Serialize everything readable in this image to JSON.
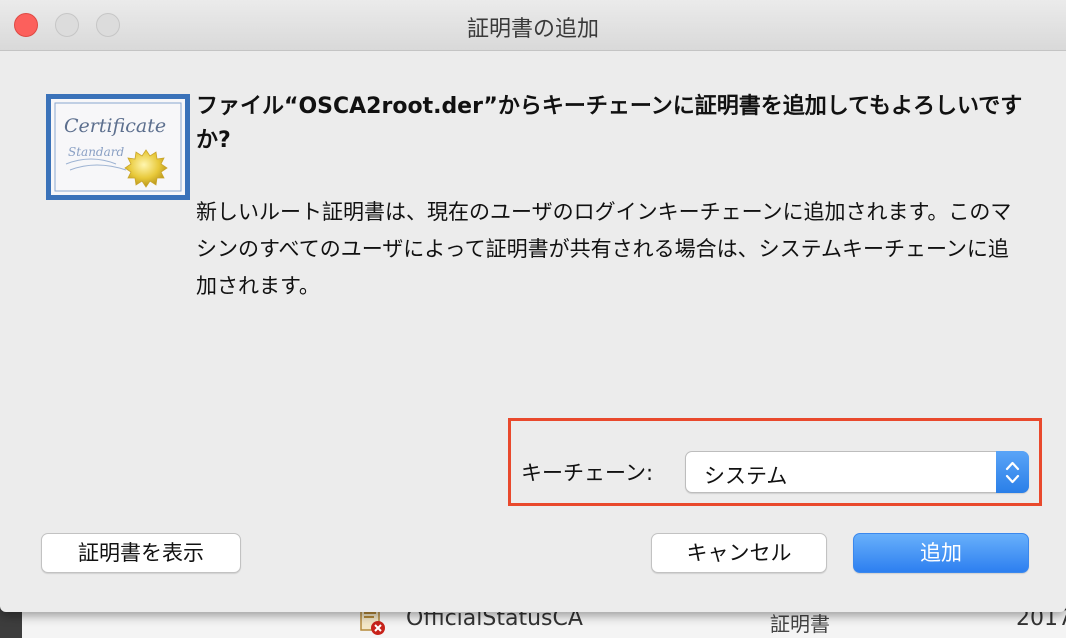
{
  "dialog": {
    "title": "証明書の追加",
    "heading": "ファイル“OSCA2root.der”からキーチェーンに証明書を追加してもよろしいですか?",
    "message": "新しいルート証明書は、現在のユーザのログインキーチェーンに追加されます。このマシンのすべてのユーザによって証明書が共有される場合は、システムキーチェーンに追加されます。",
    "cert_icon": {
      "title_text": "Certificate",
      "subtitle_text": "Standard",
      "icon": "certificate-icon"
    },
    "keychain": {
      "label": "キーチェーン:",
      "selected": "システム",
      "icon": "up-down-chevron-icon"
    },
    "buttons": {
      "view_certificate": "証明書を表示",
      "cancel": "キャンセル",
      "add": "追加"
    },
    "colors": {
      "highlight_border": "#e9492c",
      "primary_button": "#2d7ff0",
      "close_button": "#fc605c"
    }
  },
  "background": {
    "row_name": "OfficialStatusCA",
    "row_kind": "証明書",
    "row_date": "2017",
    "row_icon": "certificate-error-icon"
  }
}
